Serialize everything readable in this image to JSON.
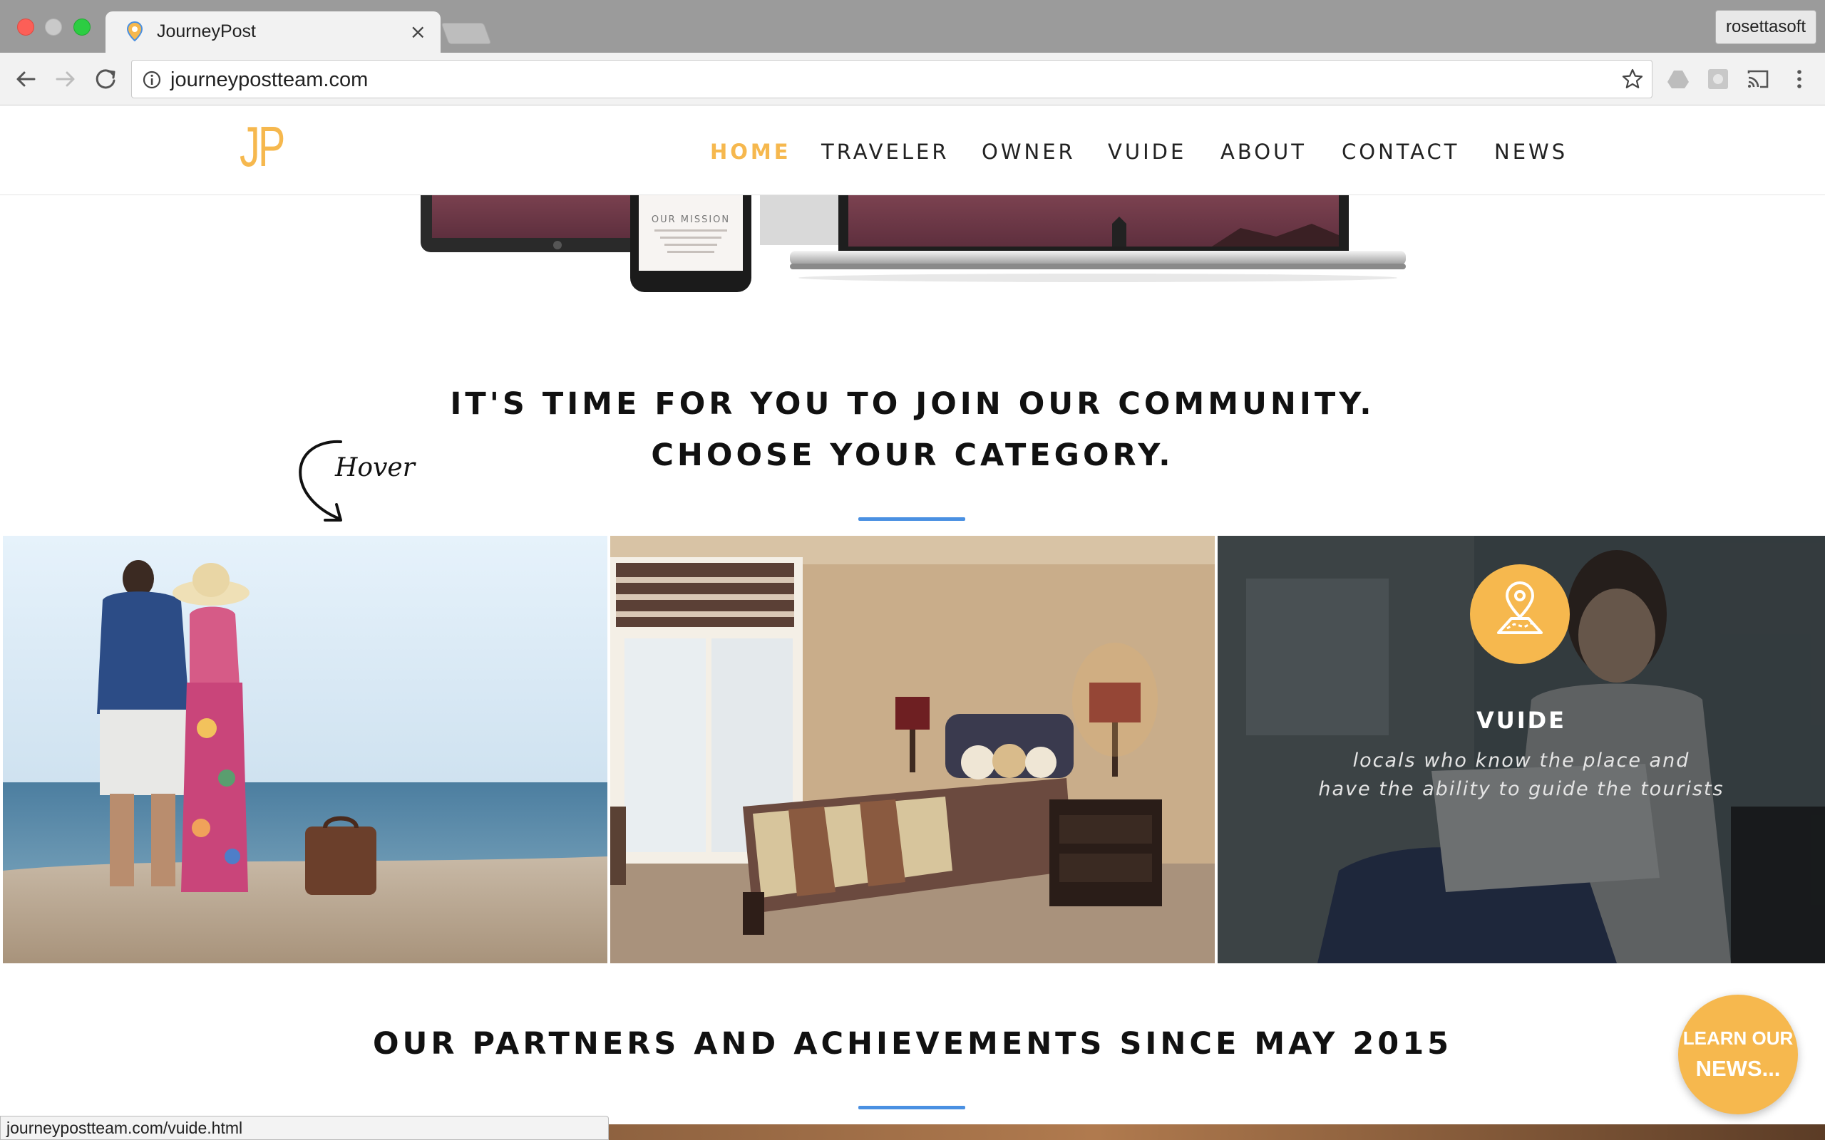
{
  "browser": {
    "tab_title": "JourneyPost",
    "tab_close": "×",
    "profile_name": "rosettasoft",
    "url": "journeypostteam.com",
    "status_url": "journeypostteam.com/vuide.html"
  },
  "header": {
    "logo": "JP",
    "nav": [
      "HOME",
      "TRAVELER",
      "OWNER",
      "VUIDE",
      "ABOUT",
      "CONTACT",
      "NEWS"
    ],
    "active": "HOME",
    "accent_color": "#f6b84e"
  },
  "hero": {
    "phone_heading": "OUR MISSION"
  },
  "community": {
    "line1": "IT'S TIME FOR YOU TO JOIN OUR COMMUNITY.",
    "line2": "CHOOSE YOUR CATEGORY.",
    "hover_note": "Hover",
    "divider_color": "#4a90e2"
  },
  "categories": [
    {
      "key": "traveler",
      "image": "couple on beach with suitcase"
    },
    {
      "key": "owner",
      "image": "bedroom interior"
    },
    {
      "key": "vuide",
      "image": "woman with laptop",
      "title": "VUIDE",
      "desc_line1": "locals who know the place and",
      "desc_line2": "have the ability to guide the tourists",
      "icon": "map-pin-icon"
    }
  ],
  "partners": {
    "heading": "OUR PARTNERS AND ACHIEVEMENTS SINCE MAY 2015"
  },
  "fab": {
    "line1": "LEARN OUR",
    "line2": "NEWS..."
  }
}
